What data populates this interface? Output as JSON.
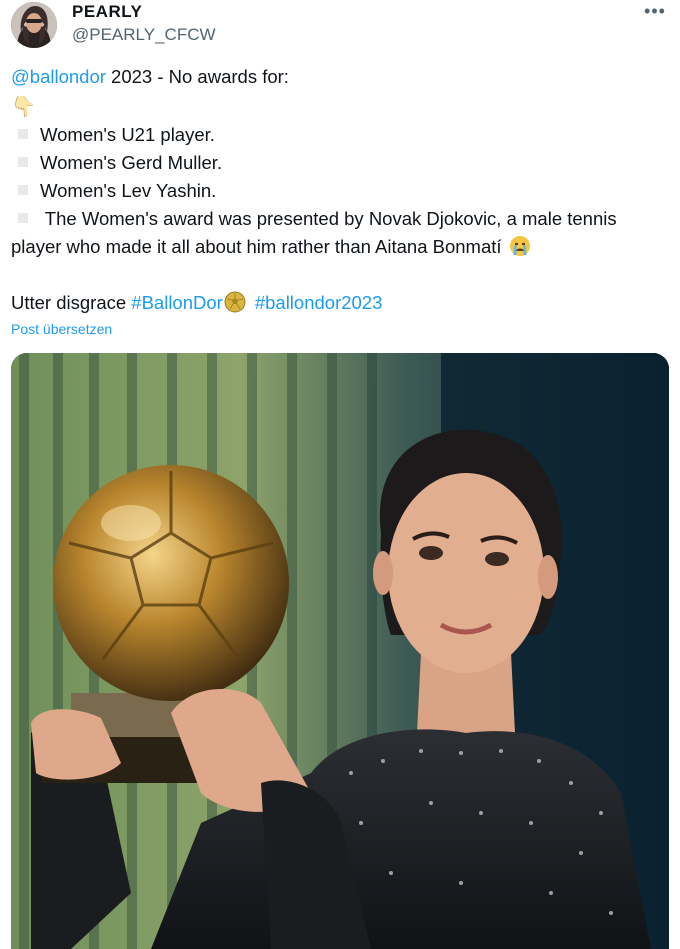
{
  "author": {
    "display_name": "PEARLY",
    "handle": "@PEARLY_CFCW",
    "avatar_icon": "profile-avatar"
  },
  "more_label": "•••",
  "tweet": {
    "mention": "@ballondor",
    "intro_rest": " 2023 - No awards for:",
    "pointing_icon": "pointing-down-icon",
    "pointing_glyph": "👇",
    "items": [
      "Women's U21 player.",
      "Women's Gerd Muller.",
      "Women's Lev Yashin.",
      " The Women's award was presented by Novak Djokovic, a male tennis"
    ],
    "continuation": "player who made it all about him rather than Aitana Bonmatí",
    "closing_text": "Utter disgrace ",
    "hashtag1": "#BallonDor",
    "hashtag2": "#ballondor2023"
  },
  "translate_label": "Post übersetzen",
  "colors": {
    "link": "#1d9bf0",
    "text": "#0f1419",
    "secondary": "#536471"
  }
}
